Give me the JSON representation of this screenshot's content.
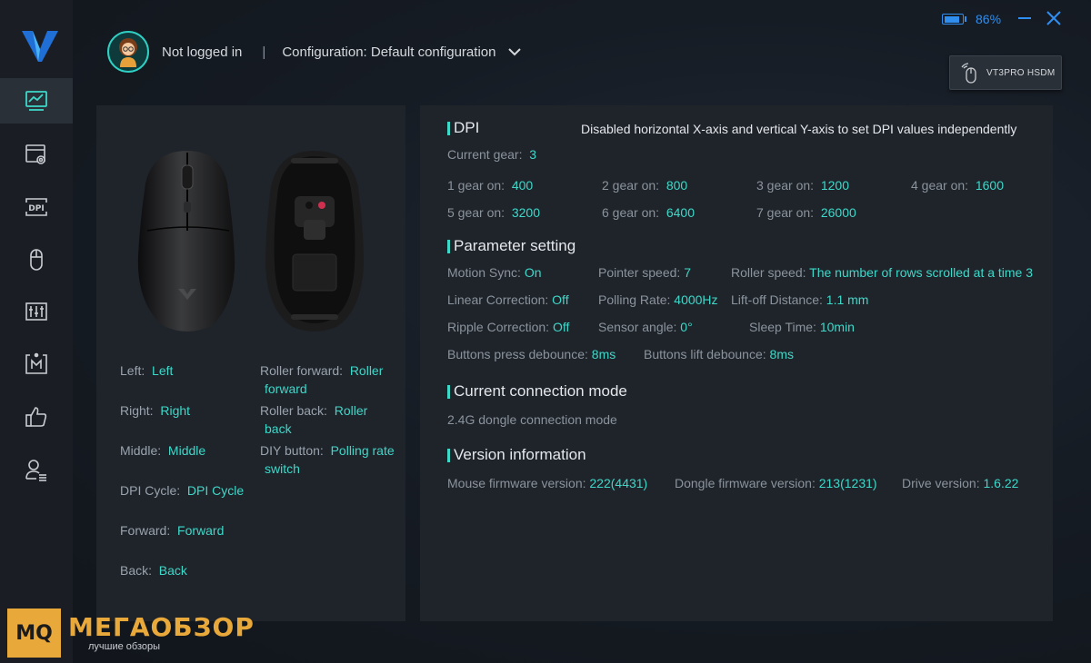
{
  "user": {
    "status": "Not logged in"
  },
  "separator": "|",
  "configuration": {
    "label": "Configuration: Default configuration"
  },
  "battery": {
    "percent_text": "86%",
    "level": 0.86
  },
  "device": {
    "name": "VT3PRO HSDM"
  },
  "colors": {
    "accent": "#3ed8c9",
    "battery": "#2f8ef0",
    "sidebar": "#1a1e24",
    "panel": "#1f242b"
  },
  "sidebar": {
    "items": [
      {
        "icon": "performance-chart-icon",
        "active": true
      },
      {
        "icon": "window-settings-icon"
      },
      {
        "icon": "dpi-icon"
      },
      {
        "icon": "mouse-icon"
      },
      {
        "icon": "sliders-icon"
      },
      {
        "icon": "macro-icon"
      },
      {
        "icon": "thumbs-up-icon"
      },
      {
        "icon": "user-list-icon"
      }
    ]
  },
  "buttons": {
    "left": {
      "label": "Left:",
      "value": "Left"
    },
    "right": {
      "label": "Right:",
      "value": "Right"
    },
    "middle": {
      "label": "Middle:",
      "value": "Middle"
    },
    "dpi_cycle": {
      "label": "DPI Cycle:",
      "value": "DPI Cycle"
    },
    "forward": {
      "label": "Forward:",
      "value": "Forward"
    },
    "back": {
      "label": "Back:",
      "value": "Back"
    },
    "roller_forward": {
      "label": "Roller forward:",
      "value_line1": "Roller",
      "value_line2": "forward"
    },
    "roller_back": {
      "label": "Roller back:",
      "value_line1": "Roller",
      "value_line2": "back"
    },
    "diy_button": {
      "label": "DIY button:",
      "value_line1": "Polling rate",
      "value_line2": "switch"
    }
  },
  "dpi": {
    "title": "DPI",
    "note": "Disabled horizontal X-axis and vertical Y-axis to set DPI values independently",
    "current_gear_label": "Current gear:",
    "current_gear": "3",
    "gears": [
      {
        "label": "1 gear on:",
        "value": "400"
      },
      {
        "label": "2 gear on:",
        "value": "800"
      },
      {
        "label": "3 gear on:",
        "value": "1200"
      },
      {
        "label": "4 gear on:",
        "value": "1600"
      },
      {
        "label": "5 gear on:",
        "value": "3200"
      },
      {
        "label": "6 gear on:",
        "value": "6400"
      },
      {
        "label": "7 gear on:",
        "value": "26000"
      }
    ]
  },
  "params": {
    "title": "Parameter setting",
    "motion_sync": {
      "label": "Motion Sync:",
      "value": "On"
    },
    "pointer_speed": {
      "label": "Pointer speed:",
      "value": "7"
    },
    "roller_speed": {
      "label": "Roller speed:",
      "value": "The number of rows scrolled at a time 3"
    },
    "linear_correction": {
      "label": "Linear Correction:",
      "value": "Off"
    },
    "polling_rate": {
      "label": "Polling Rate:",
      "value": "4000Hz"
    },
    "lift_off": {
      "label": "Lift-off Distance:",
      "value": "1.1 mm"
    },
    "ripple_correction": {
      "label": "Ripple Correction:",
      "value": "Off"
    },
    "sensor_angle": {
      "label": "Sensor angle:",
      "value": "0°"
    },
    "sleep_time": {
      "label": "Sleep Time:",
      "value": "10min"
    },
    "press_debounce": {
      "label": "Buttons press debounce:",
      "value": "8ms"
    },
    "lift_debounce": {
      "label": "Buttons lift debounce:",
      "value": "8ms"
    }
  },
  "connection": {
    "title": "Current connection mode",
    "mode": "2.4G dongle connection mode"
  },
  "version": {
    "title": "Version information",
    "mouse_fw": {
      "label": "Mouse firmware version:",
      "value": "222(4431)"
    },
    "dongle_fw": {
      "label": "Dongle firmware version:",
      "value": "213(1231)"
    },
    "driver": {
      "label": "Drive version:",
      "value": "1.6.22"
    }
  },
  "watermark": {
    "box": "MQ",
    "title": "МЕГАОБЗОР",
    "subtitle": "лучшие обзоры"
  }
}
